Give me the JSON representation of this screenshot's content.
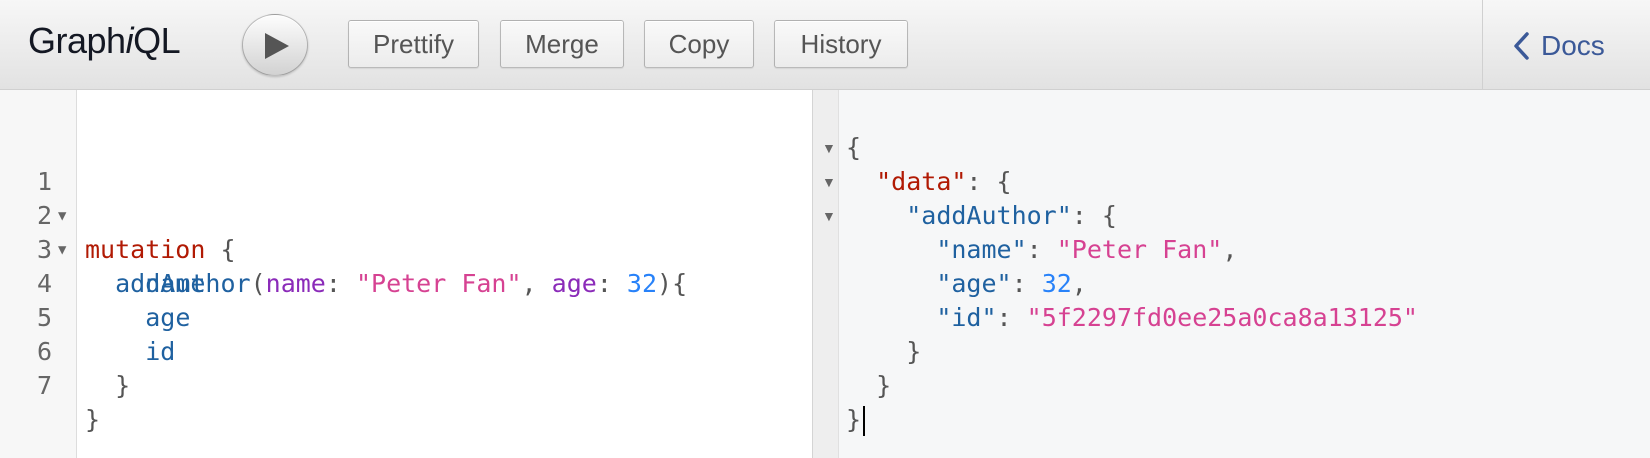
{
  "toolbar": {
    "title_prefix": "Graph",
    "title_italic": "i",
    "title_suffix": "QL",
    "prettify_label": "Prettify",
    "merge_label": "Merge",
    "copy_label": "Copy",
    "history_label": "History",
    "docs_label": "Docs"
  },
  "query_editor": {
    "line_numbers": [
      "1",
      "2",
      "3",
      "4",
      "5",
      "6",
      "7"
    ],
    "line1": {
      "keyword": "mutation",
      "rest": " {"
    },
    "line2": {
      "field": "addAuthor",
      "open": "(",
      "arg1": "name",
      "colon1": ": ",
      "val1": "\"Peter Fan\"",
      "comma": ", ",
      "arg2": "age",
      "colon2": ": ",
      "val2": "32",
      "close": "){"
    },
    "line3": "name",
    "line4": "age",
    "line5": "id",
    "line6": "}",
    "line7": "}"
  },
  "result_viewer": {
    "open_brace": "{",
    "data_key": "\"data\"",
    "data_sep": ": {",
    "author_key": "\"addAuthor\"",
    "author_sep": ": {",
    "name_key": "\"name\"",
    "name_value": "\"Peter Fan\"",
    "age_key": "\"age\"",
    "age_value": "32",
    "id_key": "\"id\"",
    "id_value": "\"5f2297fd0ee25a0ca8a13125\"",
    "colon": ": ",
    "comma": ",",
    "close_brace": "}"
  }
}
